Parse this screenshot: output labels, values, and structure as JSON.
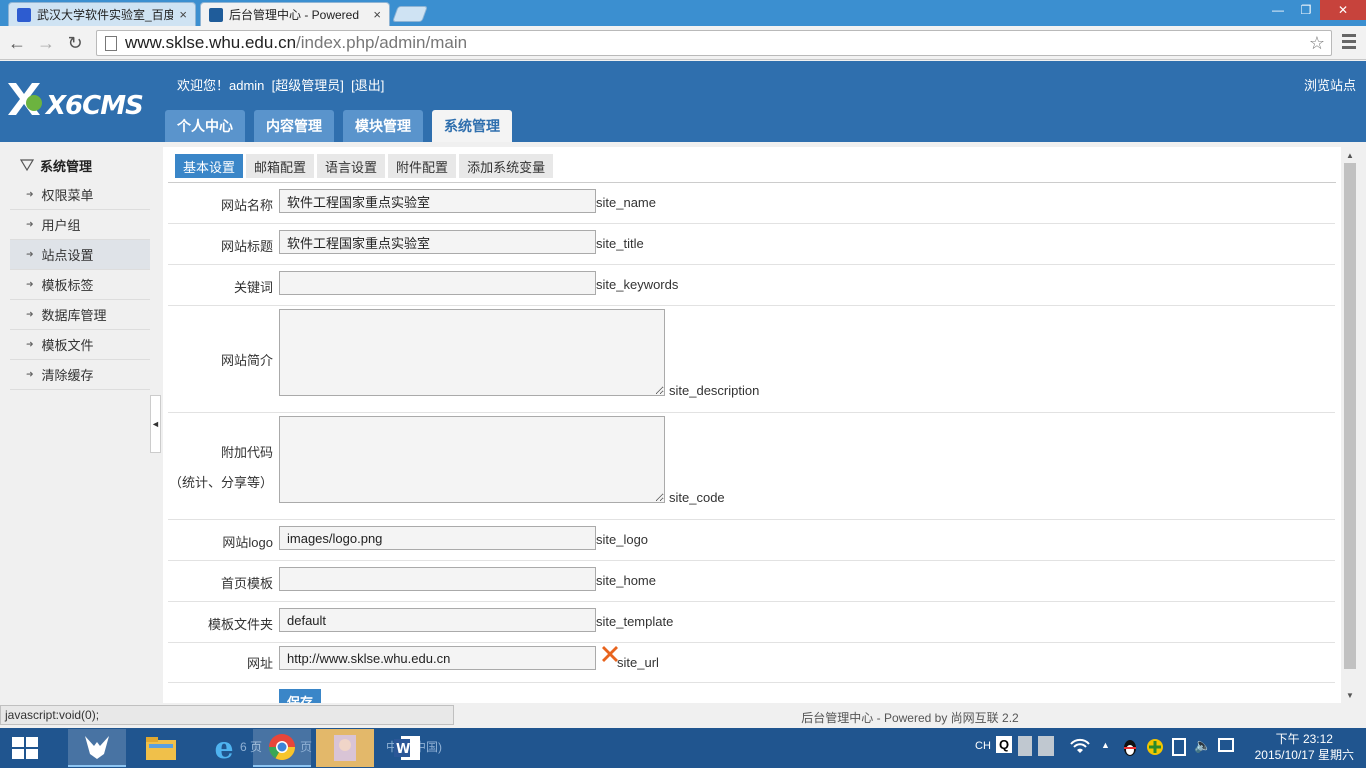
{
  "browser": {
    "tabs": [
      {
        "title": "武汉大学软件实验室_百度",
        "active": false
      },
      {
        "title": "后台管理中心 - Powered",
        "active": true
      }
    ],
    "url_host": "www.sklse.whu.edu.cn",
    "url_path": "/index.php/admin/main",
    "close_glyph": "×"
  },
  "header": {
    "logo_text": "X6CMS",
    "welcome": "欢迎您！admin",
    "role": "[超级管理员]",
    "logout": "[退出]",
    "browse_site": "浏览站点",
    "tabs": [
      "个人中心",
      "内容管理",
      "模块管理",
      "系统管理"
    ]
  },
  "sidebar": {
    "title": "系统管理",
    "items": [
      "权限菜单",
      "用户组",
      "站点设置",
      "模板标签",
      "数据库管理",
      "模板文件",
      "清除缓存"
    ],
    "collapse_glyph": "◄"
  },
  "subtabs": [
    "基本设置",
    "邮箱配置",
    "语言设置",
    "附件配置",
    "添加系统变量"
  ],
  "form": {
    "fields": [
      {
        "label": "网站名称",
        "value": "软件工程国家重点实验室",
        "var": "site_name"
      },
      {
        "label": "网站标题",
        "value": "软件工程国家重点实验室",
        "var": "site_title"
      },
      {
        "label": "关键词",
        "value": "",
        "var": "site_keywords"
      },
      {
        "label": "网站简介",
        "value": "",
        "var": "site_description"
      },
      {
        "label": "附加代码",
        "label2": "（统计、分享等）",
        "value": "",
        "var": "site_code"
      },
      {
        "label": "网站logo",
        "value": "images/logo.png",
        "var": "site_logo"
      },
      {
        "label": "首页模板",
        "value": "",
        "var": "site_home"
      },
      {
        "label": "模板文件夹",
        "value": "default",
        "var": "site_template"
      },
      {
        "label": "网址",
        "value": "http://www.sklse.whu.edu.cn",
        "var": "site_url"
      }
    ],
    "save": "保存"
  },
  "status_url": "javascript:void(0);",
  "footer": {
    "text": "后台管理中心 - Powered by",
    "brand": "尚网互联",
    "version": "2.2"
  },
  "taskbar": {
    "faint1": "6 页",
    "faint2": "页",
    "faint3": "中文(中国)",
    "lang": "CH",
    "ime": "Q",
    "time": "下午 23:12",
    "date": "2015/10/17 星期六"
  },
  "colors": {
    "header": "#2f6fae",
    "accent": "#3a86c8",
    "taskbar": "#20558f",
    "error": "#e8641e"
  }
}
